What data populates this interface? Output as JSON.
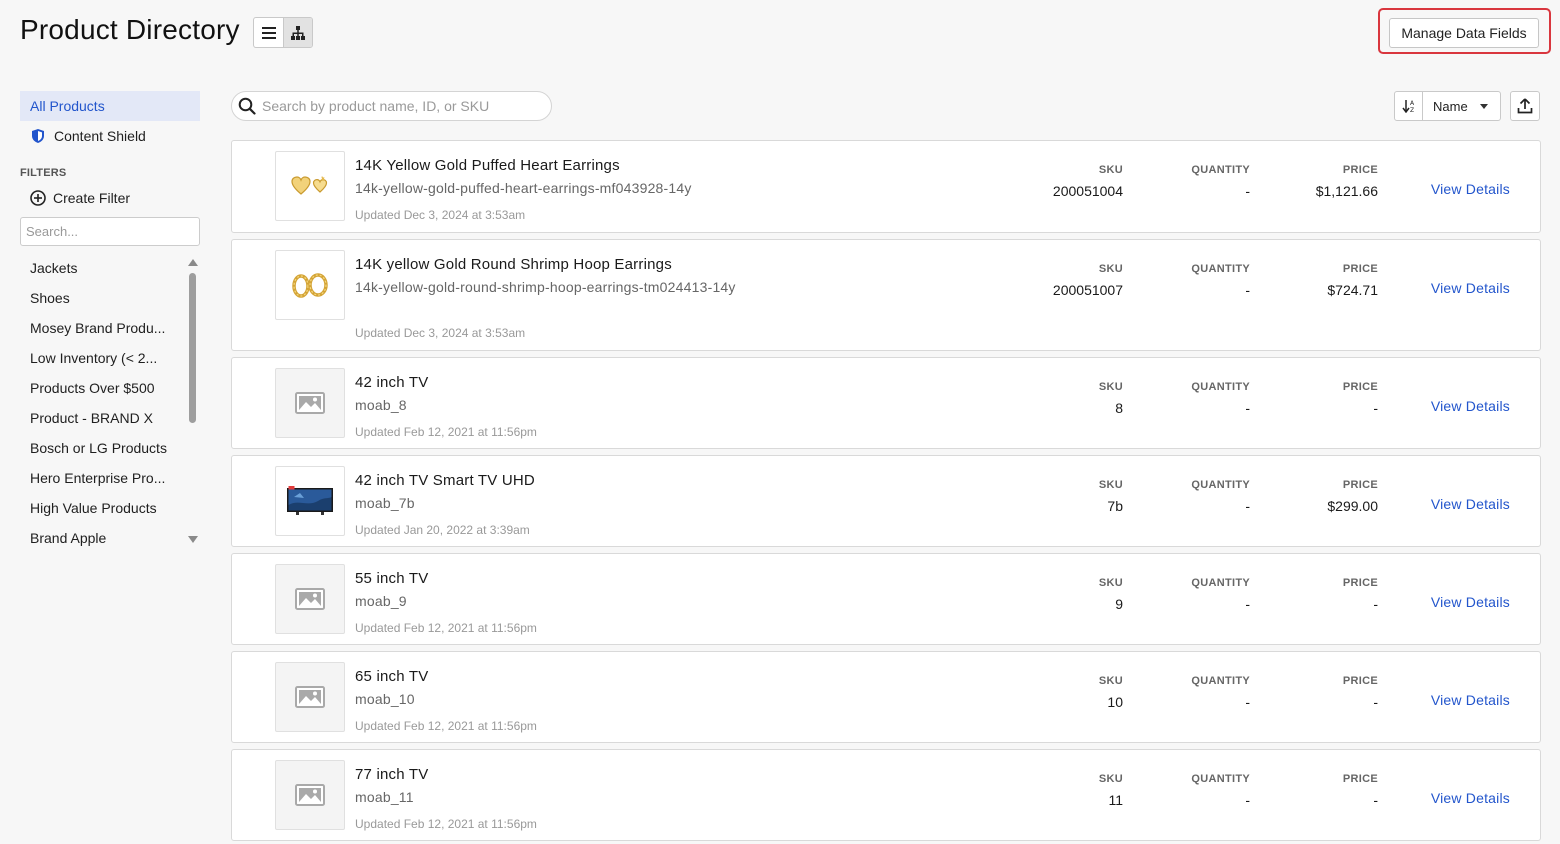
{
  "header": {
    "title": "Product Directory",
    "manage_label": "Manage Data Fields"
  },
  "sidebar": {
    "all_products": "All Products",
    "content_shield": "Content Shield",
    "filters_label": "FILTERS",
    "create_filter": "Create Filter",
    "search_placeholder": "Search...",
    "filters": [
      "Jackets",
      "Shoes",
      "Mosey Brand Produ...",
      "Low Inventory (< 2...",
      "Products Over $500",
      "Product - BRAND X",
      "Bosch or LG Products",
      "Hero Enterprise Pro...",
      "High Value Products",
      "Brand Apple"
    ]
  },
  "toolbar": {
    "search_placeholder": "Search by product name, ID, or SKU",
    "sort_label": "Name"
  },
  "columns": {
    "sku": "SKU",
    "quantity": "QUANTITY",
    "price": "PRICE"
  },
  "view_details_label": "View Details",
  "products": [
    {
      "name": "14K Yellow Gold Puffed Heart Earrings",
      "slug": "14k-yellow-gold-puffed-heart-earrings-mf043928-14y",
      "updated": "Updated Dec 3, 2024 at 3:53am",
      "sku": "200051004",
      "quantity": "-",
      "price": "$1,121.66",
      "image": "heart-earrings-image"
    },
    {
      "name": "14K yellow Gold Round Shrimp Hoop Earrings",
      "slug": "14k-yellow-gold-round-shrimp-hoop-earrings-tm024413-14y",
      "updated": "Updated Dec 3, 2024 at 3:53am",
      "sku": "200051007",
      "quantity": "-",
      "price": "$724.71",
      "image": "hoop-earrings-image"
    },
    {
      "name": "42 inch TV",
      "slug": "moab_8",
      "updated": "Updated Feb 12, 2021 at 11:56pm",
      "sku": "8",
      "quantity": "-",
      "price": "-",
      "image": "placeholder-image-icon"
    },
    {
      "name": "42 inch TV Smart TV UHD",
      "slug": "moab_7b",
      "updated": "Updated Jan 20, 2022 at 3:39am",
      "sku": "7b",
      "quantity": "-",
      "price": "$299.00",
      "image": "tv-image"
    },
    {
      "name": "55 inch TV",
      "slug": "moab_9",
      "updated": "Updated Feb 12, 2021 at 11:56pm",
      "sku": "9",
      "quantity": "-",
      "price": "-",
      "image": "placeholder-image-icon"
    },
    {
      "name": "65 inch TV",
      "slug": "moab_10",
      "updated": "Updated Feb 12, 2021 at 11:56pm",
      "sku": "10",
      "quantity": "-",
      "price": "-",
      "image": "placeholder-image-icon"
    },
    {
      "name": "77 inch TV",
      "slug": "moab_11",
      "updated": "Updated Feb 12, 2021 at 11:56pm",
      "sku": "11",
      "quantity": "-",
      "price": "-",
      "image": "placeholder-image-icon"
    }
  ],
  "colors": {
    "accent": "#2255cc",
    "highlight_border": "#d9363e",
    "active_nav_bg": "#e3e8f7"
  }
}
